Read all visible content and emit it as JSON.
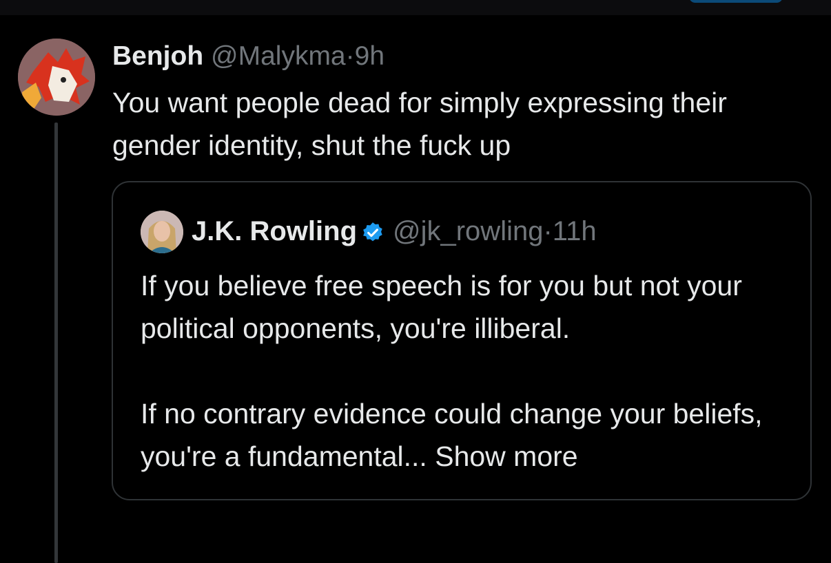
{
  "reply": {
    "author_name": "Benjoh",
    "author_handle": "@Malykma",
    "separator": "·",
    "time": "9h",
    "text": "You want people dead for simply expressing their gender identity, shut the fuck up"
  },
  "quoted": {
    "author_name": "J.K. Rowling",
    "author_handle": "@jk_rowling",
    "separator": "·",
    "time": "11h",
    "paragraph_1": "If you believe free speech is for you but not your political opponents, you're illiberal.",
    "paragraph_2": "If no contrary evidence could change your beliefs, you're a fundamental...",
    "show_more_label": "Show more"
  },
  "colors": {
    "background": "#000000",
    "text_primary": "#e7e9ea",
    "text_secondary": "#71767b",
    "verified": "#1d9bf0",
    "border": "#2f3336"
  },
  "icons": {
    "verified": "verified-badge-icon"
  }
}
